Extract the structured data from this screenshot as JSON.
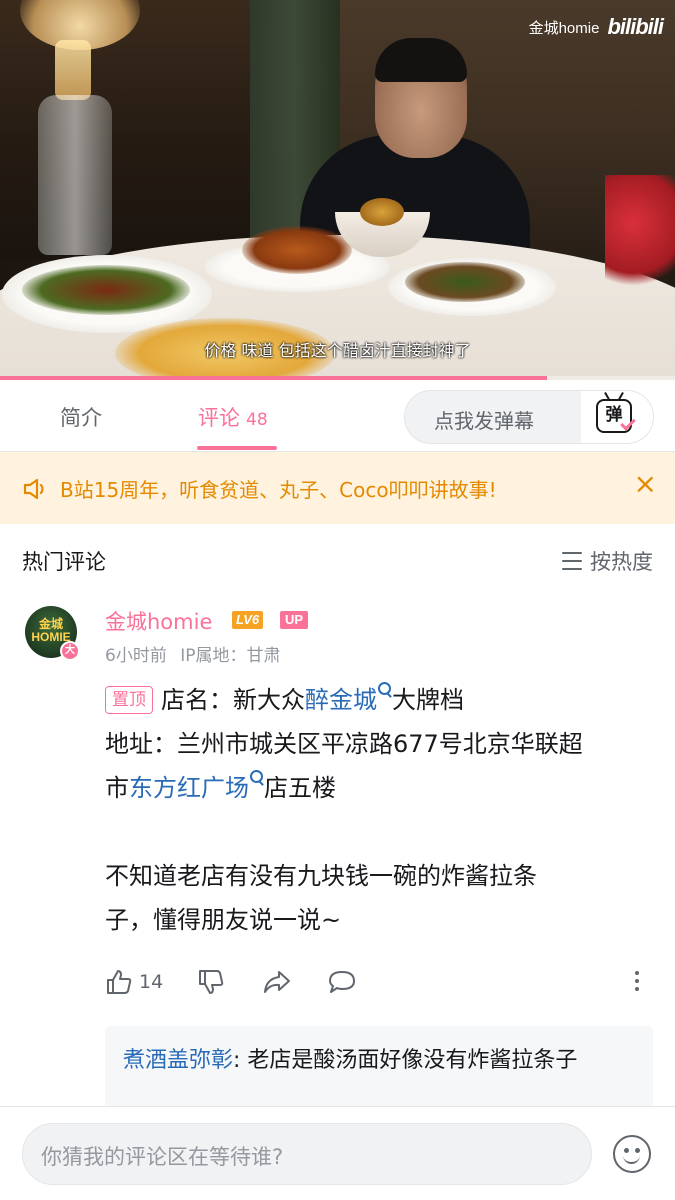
{
  "video": {
    "watermark_user": "金城homie",
    "watermark_logo": "bilibili",
    "subtitle": "价格 味道 包括这个醋卤汁直接封神了",
    "progress_fraction": 0.81
  },
  "tabs": {
    "intro_label": "简介",
    "comments_label": "评论",
    "comments_count": "48",
    "danmaku_placeholder": "点我发弹幕",
    "danmaku_icon_char": "弹"
  },
  "notice": {
    "text": "B站15周年，听食贫道、丸子、Coco叩叩讲故事!",
    "close_symbol": "×"
  },
  "section": {
    "title": "热门评论",
    "sort_label": "按热度"
  },
  "comment": {
    "avatar_text_line1": "金城",
    "avatar_text_line2": "HOMIE",
    "avatar_badge": "大",
    "username": "金城homie",
    "level": "LV6",
    "up_badge": "UP",
    "time": "6小时前",
    "ip": "IP属地：甘肃",
    "pin_label": "置顶",
    "line1_prefix": "店名：新大众",
    "line1_keyword": "醉金城",
    "line1_suffix": "大牌档",
    "line2": "地址：兰州市城关区平凉路677号北京华联超",
    "line3_prefix": "市",
    "line3_keyword": "东方红广场",
    "line3_suffix": "店五楼",
    "line4": "不知道老店有没有九块钱一碗的炸酱拉条",
    "line5": "子，懂得朋友说一说~",
    "like_count": "14"
  },
  "reply": {
    "user": "煮酒盖弥彰",
    "text": ": 老店是酸汤面好像没有炸酱拉条子"
  },
  "bottom": {
    "input_placeholder": "你猜我的评论区在等待谁?"
  },
  "colors": {
    "accent_pink": "#fb7299",
    "link_blue": "#2a6bb8",
    "notice_bg": "#fff3e0",
    "notice_text": "#e58a00"
  }
}
